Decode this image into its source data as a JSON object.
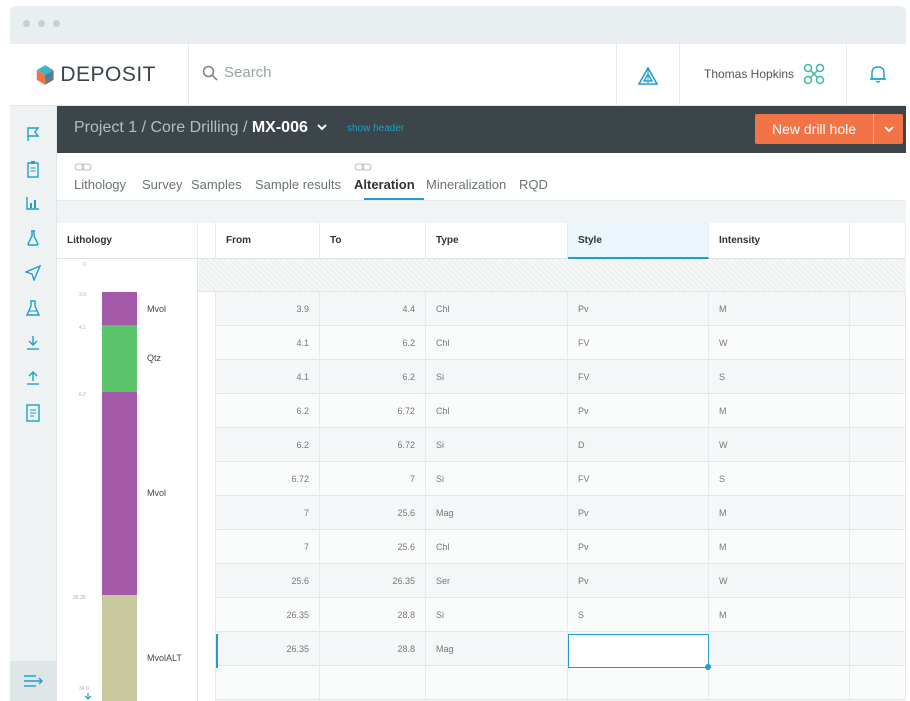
{
  "app": {
    "logo_text": "DEPOSIT",
    "search_placeholder": "Search",
    "user_name": "Thomas Hopkins"
  },
  "project_bar": {
    "breadcrumb_path": "Project 1 / Core Drilling / ",
    "current_hole": "MX-006",
    "show_header_link": "show header",
    "new_button_label": "New drill hole"
  },
  "tabs": [
    {
      "label": "Lithology",
      "active": false,
      "linked": true
    },
    {
      "label": "Survey",
      "active": false,
      "linked": false
    },
    {
      "label": "Samples",
      "active": false,
      "linked": false
    },
    {
      "label": "Sample results",
      "active": false,
      "linked": false
    },
    {
      "label": "Alteration",
      "active": true,
      "linked": true
    },
    {
      "label": "Mineralization",
      "active": false,
      "linked": false
    },
    {
      "label": "RQD",
      "active": false,
      "linked": false
    }
  ],
  "table": {
    "headers": {
      "lithology": "Lithology",
      "from": "From",
      "to": "To",
      "type": "Type",
      "style": "Style",
      "intensity": "Intensity"
    },
    "active_column": "style",
    "rows": [
      {
        "from": "3.9",
        "to": "4.4",
        "type": "Chl",
        "style": "Pv",
        "intensity": "M"
      },
      {
        "from": "4.1",
        "to": "6.2",
        "type": "Chl",
        "style": "FV",
        "intensity": "W"
      },
      {
        "from": "4.1",
        "to": "6.2",
        "type": "Si",
        "style": "FV",
        "intensity": "S"
      },
      {
        "from": "6.2",
        "to": "6.72",
        "type": "Chl",
        "style": "Pv",
        "intensity": "M"
      },
      {
        "from": "6.2",
        "to": "6.72",
        "type": "Si",
        "style": "D",
        "intensity": "W"
      },
      {
        "from": "6.72",
        "to": "7",
        "type": "Si",
        "style": "FV",
        "intensity": "S"
      },
      {
        "from": "7",
        "to": "25.6",
        "type": "Mag",
        "style": "Pv",
        "intensity": "M"
      },
      {
        "from": "7",
        "to": "25.6",
        "type": "Chl",
        "style": "Pv",
        "intensity": "M"
      },
      {
        "from": "25.6",
        "to": "26.35",
        "type": "Ser",
        "style": "Pv",
        "intensity": "W"
      },
      {
        "from": "26.35",
        "to": "28.8",
        "type": "Si",
        "style": "S",
        "intensity": "M"
      },
      {
        "from": "26.35",
        "to": "28.8",
        "type": "Mag",
        "style": "",
        "intensity": ""
      }
    ]
  },
  "lithology_log": {
    "depth_labels": [
      "0",
      "3.9",
      "4.1",
      "6.2",
      "26.35",
      "34.9"
    ],
    "units": [
      {
        "name": "Mvol",
        "color": "#a45aa8"
      },
      {
        "name": "Qtz",
        "color": "#5cc46b"
      },
      {
        "name": "Mvol",
        "color": "#a45aa8"
      },
      {
        "name": "MvolALT",
        "color": "#c9c9a0"
      }
    ]
  },
  "colors": {
    "accent": "#1f9fc9",
    "primary_button": "#f27345",
    "project_bar": "#3c4549"
  },
  "icons": {
    "nav": [
      "flag-icon",
      "clipboard-icon",
      "chart-icon",
      "flask-icon",
      "send-icon",
      "lab-icon",
      "download-icon",
      "upload-icon",
      "document-icon"
    ],
    "header": [
      "search-icon",
      "triangle-logo-icon",
      "drone-icon",
      "bell-icon"
    ]
  }
}
